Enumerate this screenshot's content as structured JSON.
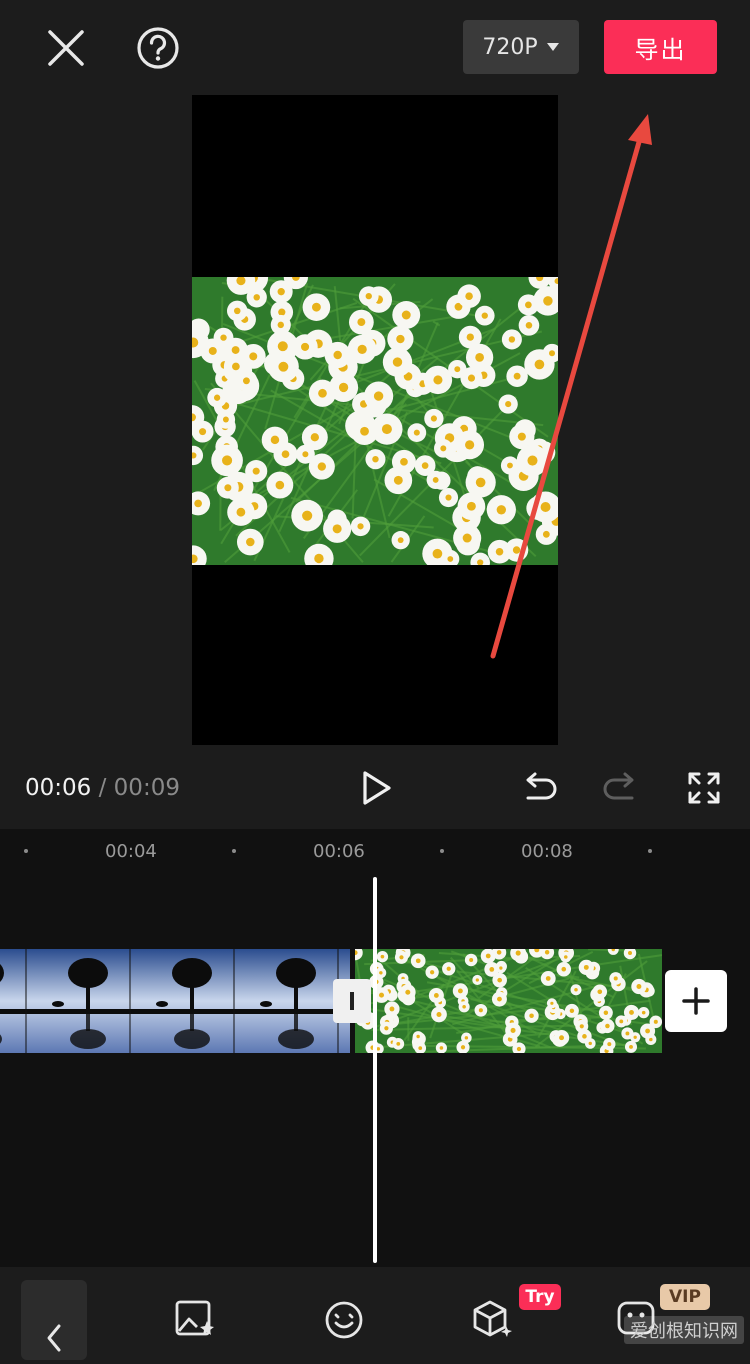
{
  "top_bar": {
    "resolution_label": "720P",
    "export_label": "导出",
    "close_icon": "close-icon",
    "help_icon": "help-icon"
  },
  "playback": {
    "current_time": "00:06",
    "separator": " / ",
    "total_time": "00:09"
  },
  "timeline": {
    "ruler_labels": [
      "00:04",
      "00:06",
      "00:08"
    ]
  },
  "toolbar": {
    "try_badge": "Try",
    "vip_badge": "VIP"
  },
  "watermark": "爱创根知识网",
  "colors": {
    "accent": "#fb2e57",
    "vip": "#e8c9a8",
    "background": "#1c1c1c",
    "timeline_bg": "#111111"
  }
}
